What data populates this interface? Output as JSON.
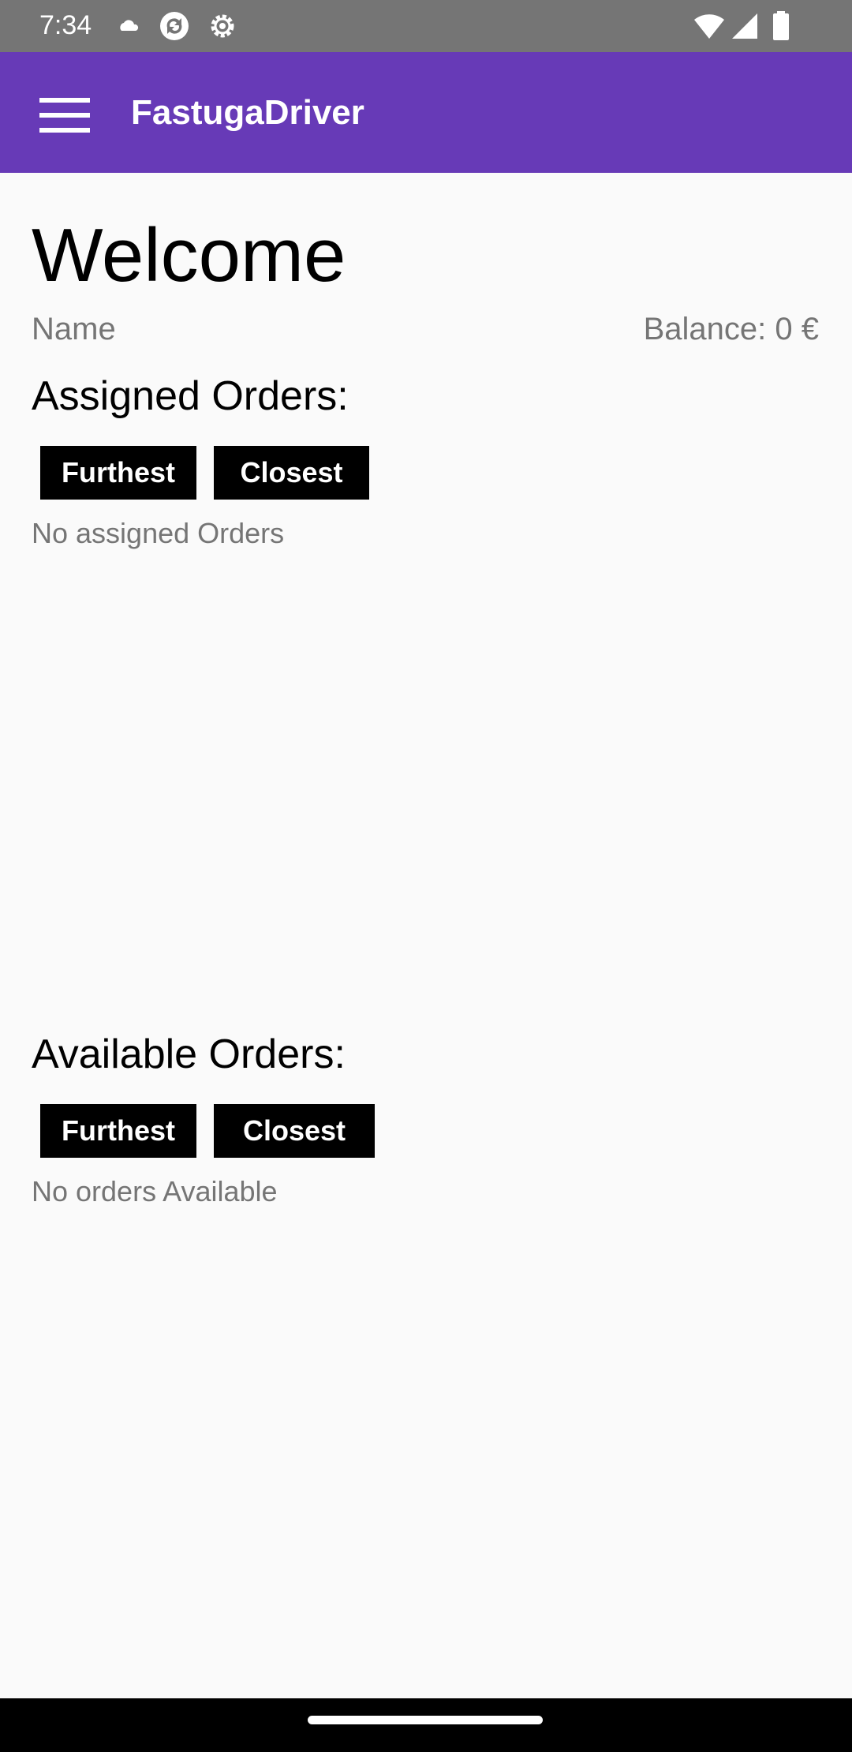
{
  "status_bar": {
    "time": "7:34",
    "icons": [
      "cloud-icon",
      "sync-icon",
      "settings-gear-icon",
      "wifi-icon",
      "cell-signal-icon",
      "battery-icon"
    ]
  },
  "app_bar": {
    "title": "FastugaDriver",
    "menu_icon": "hamburger-menu-icon",
    "color": "#673ab7"
  },
  "welcome": {
    "heading": "Welcome",
    "name_label": "Name",
    "balance": "Balance: 0 €"
  },
  "assigned_orders": {
    "title": "Assigned Orders:",
    "sort_furthest_label": "Furthest",
    "sort_closest_label": "Closest",
    "empty_message": "No assigned Orders"
  },
  "available_orders": {
    "title": "Available Orders:",
    "sort_furthest_label": "Furthest",
    "sort_closest_label": "Closest",
    "empty_message": "No orders Available"
  }
}
